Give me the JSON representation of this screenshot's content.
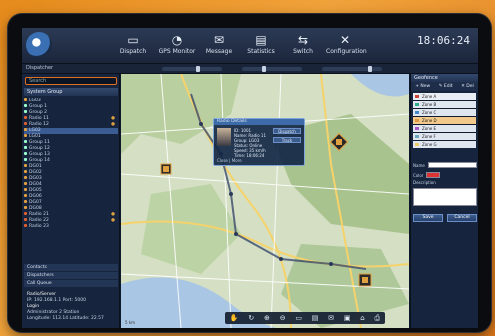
{
  "app": {
    "clock": "18:06:24",
    "date": ""
  },
  "toolbar": [
    {
      "label": "Dispatch",
      "icon": "dispatch-icon"
    },
    {
      "label": "GPS Monitor",
      "icon": "gps-icon"
    },
    {
      "label": "Message",
      "icon": "message-icon"
    },
    {
      "label": "Statistics",
      "icon": "statistics-icon"
    },
    {
      "label": "Switch",
      "icon": "switch-icon"
    },
    {
      "label": "Configuration",
      "icon": "configuration-icon"
    }
  ],
  "strip": {
    "label": "Dispatcher"
  },
  "sidebar": {
    "search_placeholder": "Search",
    "section_title": "System Group",
    "tree": [
      {
        "label": "LG03",
        "color": "#e0a040",
        "count": "",
        "sel": false
      },
      {
        "label": "Group 1",
        "color": "#9fc",
        "count": "",
        "sel": false
      },
      {
        "label": "Group 2",
        "color": "#9fc",
        "count": "",
        "sel": false
      },
      {
        "label": "Radio 11",
        "color": "#e06030",
        "count": "●",
        "sel": false
      },
      {
        "label": "Radio 12",
        "color": "#e06030",
        "count": "●",
        "sel": false
      },
      {
        "label": "LG02",
        "color": "#e0a040",
        "count": "",
        "sel": true
      },
      {
        "label": "LG01",
        "color": "#e0a040",
        "count": "",
        "sel": false
      },
      {
        "label": "Group 11",
        "color": "#9fc",
        "count": "",
        "sel": false
      },
      {
        "label": "Group 12",
        "color": "#9fc",
        "count": "",
        "sel": false
      },
      {
        "label": "Group 13",
        "color": "#9fc",
        "count": "",
        "sel": false
      },
      {
        "label": "Group 14",
        "color": "#9fc",
        "count": "",
        "sel": false
      },
      {
        "label": "DG01",
        "color": "#e0a040",
        "count": "",
        "sel": false
      },
      {
        "label": "DG02",
        "color": "#e0a040",
        "count": "",
        "sel": false
      },
      {
        "label": "DG03",
        "color": "#e0a040",
        "count": "",
        "sel": false
      },
      {
        "label": "DG04",
        "color": "#e0a040",
        "count": "",
        "sel": false
      },
      {
        "label": "DG05",
        "color": "#e0a040",
        "count": "",
        "sel": false
      },
      {
        "label": "DG06",
        "color": "#e0a040",
        "count": "",
        "sel": false
      },
      {
        "label": "DG07",
        "color": "#e0a040",
        "count": "",
        "sel": false
      },
      {
        "label": "DG08",
        "color": "#e0a040",
        "count": "",
        "sel": false
      },
      {
        "label": "Radio 21",
        "color": "#e06030",
        "count": "●",
        "sel": false
      },
      {
        "label": "Radio 22",
        "color": "#e06030",
        "count": "●",
        "sel": false
      },
      {
        "label": "Radio 23",
        "color": "#e06030",
        "count": "",
        "sel": false
      }
    ],
    "accordions": [
      "Contacts",
      "Dispatchers",
      "Call Queue"
    ],
    "user": {
      "line1": "Radio/Server",
      "line2": "IP: 192.168.1.1   Port: 5000",
      "line3": "Login",
      "line4": "Administrator  2 Station",
      "line5": "Longitude: 113.14  Latitude: 22.57"
    }
  },
  "popup": {
    "title": "Radio Details",
    "info": [
      "ID: 1001",
      "Name: Radio 11",
      "Group: LG03",
      "Status: Online",
      "Speed: 35 km/h",
      "Time: 18:06:24"
    ],
    "btn1": "Dispatch",
    "btn2": "Track",
    "footer": "Close  |  More"
  },
  "map": {
    "markers": [
      "Radio 11",
      "Radio 12",
      "Radio 21"
    ],
    "scale": "5 km"
  },
  "maptools": [
    "✋",
    "↻",
    "⊕",
    "⊖",
    "▭",
    "▤",
    "✉",
    "▣",
    "⌂",
    "⎙"
  ],
  "rpanel": {
    "title": "Geofence",
    "actions": [
      "+ New",
      "✎ Edit",
      "✕ Del"
    ],
    "items": [
      "Zone A",
      "Zone B",
      "Zone C",
      "Zone D",
      "Zone E",
      "Zone F",
      "Zone G"
    ],
    "form": {
      "name_label": "Name",
      "color_label": "Color",
      "desc_label": "Description"
    },
    "btn_save": "Save",
    "btn_cancel": "Cancel"
  },
  "colors": {
    "accent": "#e07020",
    "panel": "#16243d"
  }
}
